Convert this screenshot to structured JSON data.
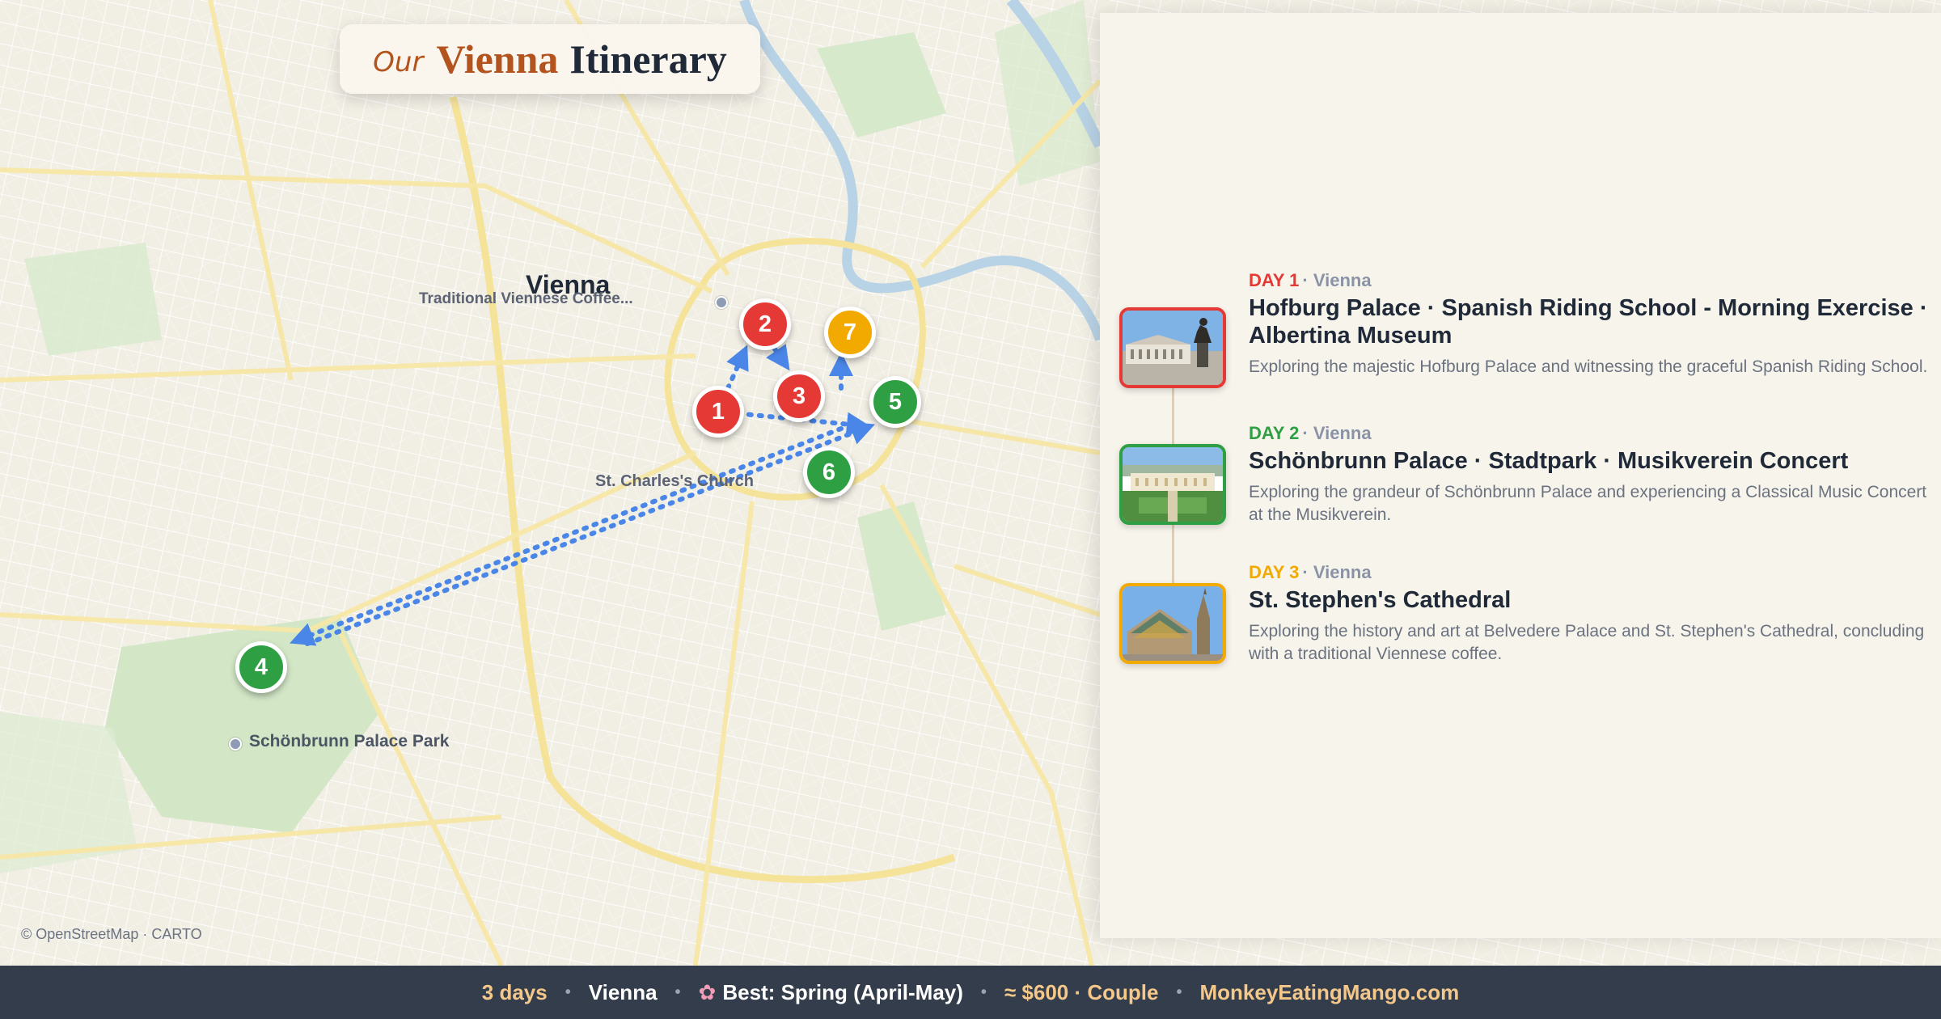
{
  "title": {
    "prefix": "Our",
    "city": "Vienna",
    "rest": "Itinerary"
  },
  "map": {
    "labels": {
      "city": "Vienna",
      "cafe": "Traditional Viennese Coffee...",
      "church": "St. Charles's Church",
      "park": "Schönbrunn Palace Park"
    },
    "attribution": "© OpenStreetMap · CARTO",
    "markers": [
      {
        "number": "1",
        "day": 1
      },
      {
        "number": "2",
        "day": 1
      },
      {
        "number": "3",
        "day": 1
      },
      {
        "number": "4",
        "day": 2
      },
      {
        "number": "5",
        "day": 2
      },
      {
        "number": "6",
        "day": 2
      },
      {
        "number": "7",
        "day": 3
      }
    ],
    "route_color": "#4a86e8"
  },
  "colors": {
    "day1": "#e53935",
    "day2": "#2ea043",
    "day3": "#f2a900"
  },
  "days": [
    {
      "label": "DAY 1",
      "location": "· Vienna",
      "title": "Hofburg Palace · Spanish Riding School - Morning Exercise · Albertina Museum",
      "description": "Exploring the majestic Hofburg Palace and witnessing the graceful Spanish Riding School."
    },
    {
      "label": "DAY 2",
      "location": "· Vienna",
      "title": "Schönbrunn Palace · Stadtpark · Musikverein Concert",
      "description": "Exploring the grandeur of Schönbrunn Palace and experiencing a Classical Music Concert at the Musikverein."
    },
    {
      "label": "DAY 3",
      "location": "· Vienna",
      "title": "St. Stephen's Cathedral",
      "description": "Exploring the history and art at Belvedere Palace and St. Stephen's Cathedral, concluding with a traditional Viennese coffee."
    }
  ],
  "footer": {
    "duration": "3 days",
    "city": "Vienna",
    "season_icon": "cherry-blossom-icon",
    "season": "Best: Spring (April-May)",
    "budget": "≈ $600 · Couple",
    "site": "MonkeyEatingMango.com"
  }
}
